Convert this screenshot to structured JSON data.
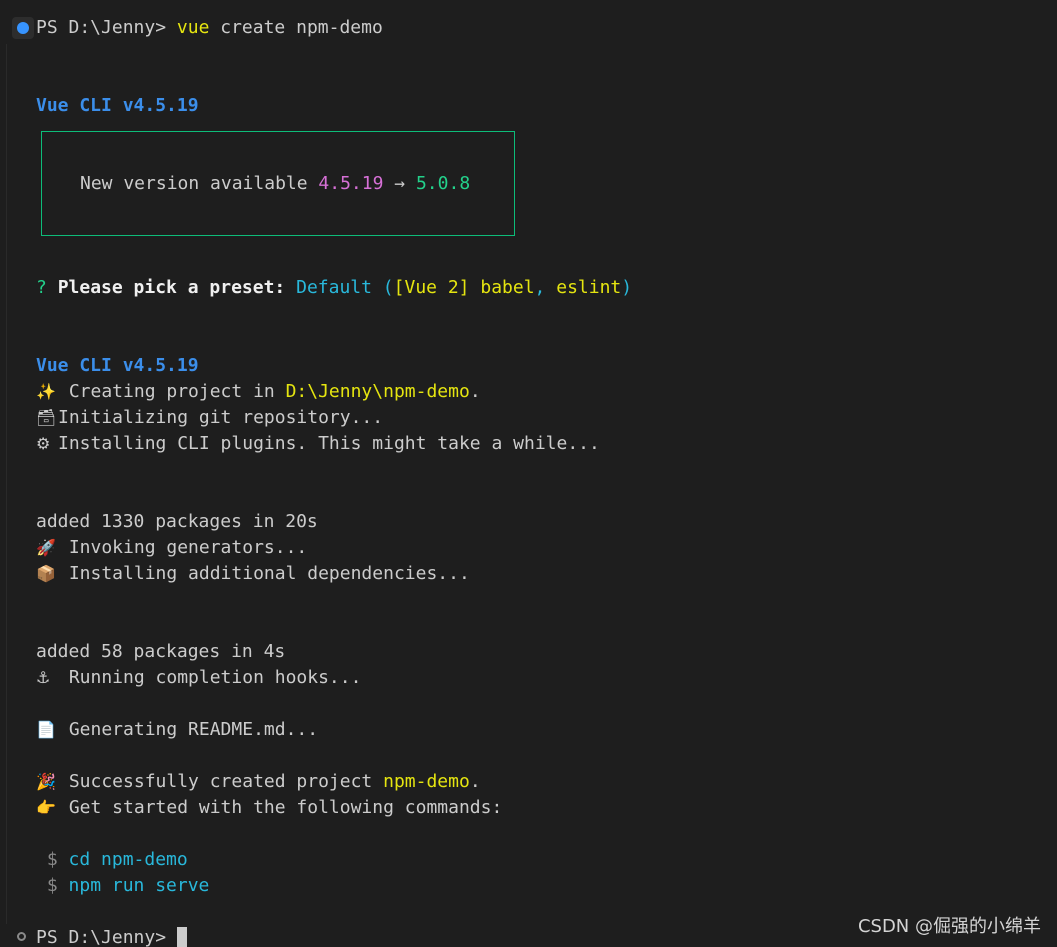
{
  "prompt": {
    "text": "PS D:\\Jenny> ",
    "cmd": "vue",
    "args": " create npm-demo"
  },
  "cli_header_1": "Vue CLI v4.5.19",
  "update_box": {
    "label": "New version available ",
    "current": "4.5.19",
    "arrow": " → ",
    "latest": "5.0.8"
  },
  "preset": {
    "mark": "? ",
    "question": "Please pick a preset: ",
    "answer": "Default",
    "open_paren": " (",
    "detail": "[Vue 2] babel",
    "comma": ", ",
    "lint": "eslint",
    "close_paren": ")"
  },
  "cli_header_2": "Vue CLI v4.5.19",
  "steps": [
    {
      "icon": "✨",
      "icon_name": "sparkles-icon",
      "pre": " Creating project in ",
      "highlight": "D:\\Jenny\\npm-demo",
      "post": "."
    },
    {
      "icon": "🗃",
      "icon_name": "card-file-box-icon",
      "pre": "Initializing git repository...",
      "highlight": "",
      "post": ""
    },
    {
      "icon": "⚙",
      "icon_name": "gear-icon",
      "pre": "Installing CLI plugins. This might take a while...",
      "highlight": "",
      "post": ""
    }
  ],
  "added_1": "added 1330 packages in 20s",
  "steps_2": [
    {
      "icon": "🚀",
      "icon_name": "rocket-icon",
      "text": " Invoking generators..."
    },
    {
      "icon": "📦",
      "icon_name": "package-icon",
      "text": " Installing additional dependencies..."
    }
  ],
  "added_2": "added 58 packages in 4s",
  "hooks": {
    "icon": "⚓",
    "icon_name": "anchor-icon",
    "text": " Running completion hooks..."
  },
  "readme": {
    "icon": "📄",
    "icon_name": "page-icon",
    "text": " Generating README.md..."
  },
  "success": {
    "icon": "🎉",
    "icon_name": "party-popper-icon",
    "pre": " Successfully created project ",
    "highlight": "npm-demo",
    "post": "."
  },
  "started": {
    "icon": "👉",
    "icon_name": "pointing-right-icon",
    "text": " Get started with the following commands:"
  },
  "commands": [
    {
      "dollar": " $ ",
      "cmd": "cd npm-demo"
    },
    {
      "dollar": " $ ",
      "cmd": "npm run serve"
    }
  ],
  "final_prompt": "PS D:\\Jenny> ",
  "watermark": "CSDN @倔强的小绵羊",
  "colors": {
    "background": "#1e1e1e",
    "text": "#cccccc",
    "yellow": "#e5e510",
    "blue": "#3b8eea",
    "green": "#23d18b",
    "cyan": "#29b8db",
    "magenta": "#d670d6",
    "box_border": "#0dbc79"
  }
}
